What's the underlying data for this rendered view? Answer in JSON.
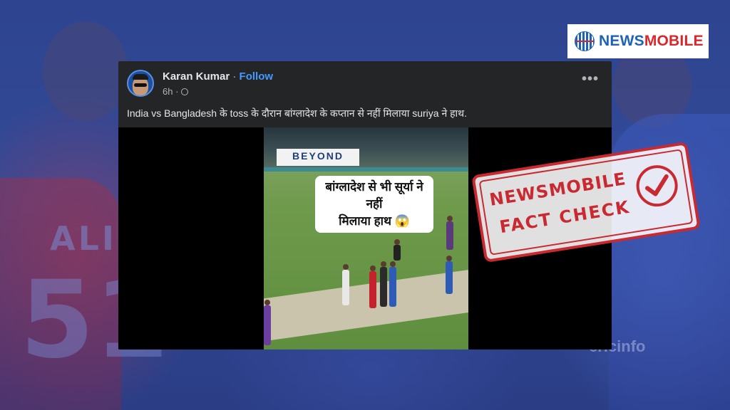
{
  "logo": {
    "news": "NEWS",
    "mobile": "MOBILE"
  },
  "post": {
    "author": "Karan Kumar",
    "separator": "·",
    "follow_label": "Follow",
    "time": "6h ·",
    "more_label": "•••",
    "caption": "India vs Bangladesh के toss के दौरान बांग्लादेश के कप्तान से नहीं मिलाया suriya ने हाथ.",
    "video": {
      "board_text": "BEYOND",
      "overlay_line1": "बांग्लादेश से भी सूर्या ने नहीं",
      "overlay_line2": "मिलाया हाथ 😱"
    }
  },
  "stamp": {
    "line1": "NEWSMOBILE",
    "line2": "FACT CHECK"
  },
  "background": {
    "jersey_name": "ALI",
    "jersey_number": "51",
    "watermark": "cricinfo"
  },
  "colors": {
    "brand_red": "#c92a32",
    "brand_blue": "#1e63b5",
    "facebook_blue": "#4599ff",
    "post_bg": "#242526"
  }
}
